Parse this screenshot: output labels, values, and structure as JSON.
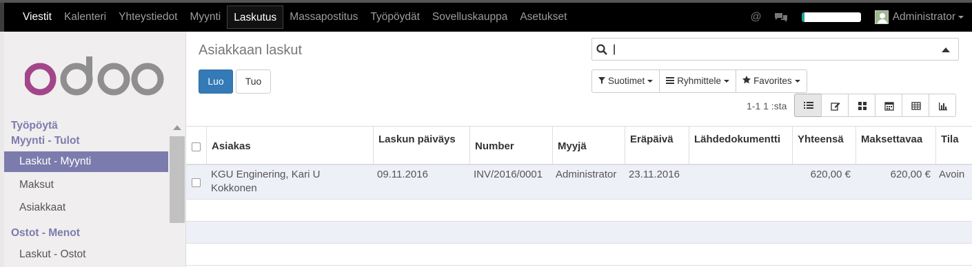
{
  "topbar": {
    "menu": [
      "Viestit",
      "Kalenteri",
      "Yhteystiedot",
      "Myynti",
      "Laskutus",
      "Massapostitus",
      "Työpöydät",
      "Sovelluskauppa",
      "Asetukset"
    ],
    "at_symbol": "@",
    "user": "Administrator"
  },
  "sidebar": {
    "logo": "odoo",
    "dashboard": "Työpöytä",
    "sales_section": "Myynti - Tulot",
    "items_sales": [
      "Laskut - Myynti",
      "Maksut",
      "Asiakkaat"
    ],
    "purchase_section": "Ostot - Menot",
    "items_purchase": [
      "Laskut - Ostot"
    ]
  },
  "main": {
    "title": "Asiakkaan laskut",
    "search_value": "|",
    "create_label": "Luo",
    "import_label": "Tuo",
    "filters_label": "Suotimet",
    "group_label": "Ryhmittele",
    "favorites_label": "Favorites",
    "pager": "1-1 1 :sta"
  },
  "table": {
    "columns": [
      "Asiakas",
      "Laskun päiväys",
      "Number",
      "Myyjä",
      "Eräpäivä",
      "Lähdedokumentti",
      "Yhteensä",
      "Maksettavaa",
      "Tila"
    ],
    "rows": [
      {
        "customer_line1": "KGU Enginering, Kari U",
        "customer_line2": "Kokkonen",
        "date": "09.11.2016",
        "number": "INV/2016/0001",
        "seller": "Administrator",
        "due": "23.11.2016",
        "source": "",
        "total": "620,00 €",
        "due_amount": "620,00 €",
        "state": "Avoin"
      }
    ]
  },
  "colors": {
    "accent": "#7c7bad",
    "primary": "#337ab7",
    "navbar": "#000000"
  }
}
